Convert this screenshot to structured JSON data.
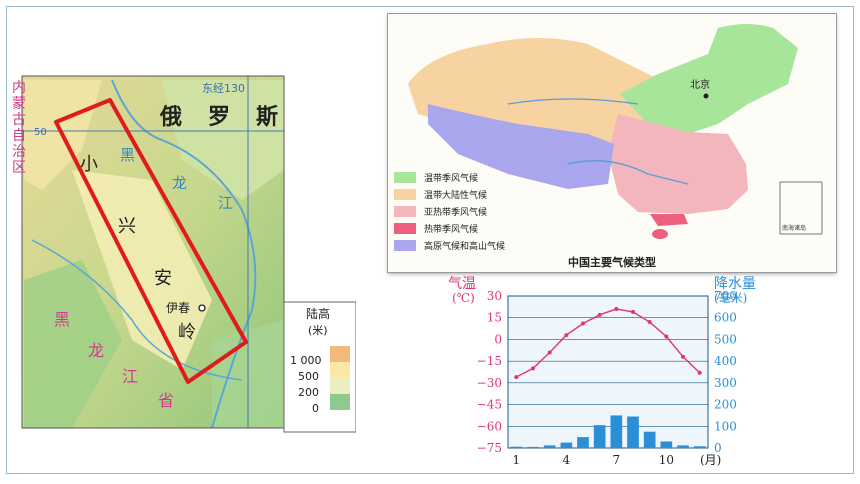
{
  "left_map": {
    "region_label": [
      "内",
      "蒙",
      "古",
      "自",
      "治",
      "区"
    ],
    "lat_label": "50",
    "lon_label": "东经130",
    "russia": [
      "俄",
      "罗",
      "斯"
    ],
    "range_name": [
      "小",
      "兴",
      "安",
      "岭"
    ],
    "river_label": [
      "黑",
      "龙",
      "江"
    ],
    "province_label": [
      "黑",
      "龙",
      "江",
      "省"
    ],
    "city": "伊春",
    "legend": {
      "title": "陆高",
      "unit": "(米)",
      "levels": [
        "1 000",
        "500",
        "200",
        "0"
      ],
      "colors": [
        "#f3b978",
        "#fbe8a6",
        "#e9efc3",
        "#8fc98b"
      ]
    }
  },
  "right_map": {
    "title": "中国主要气候类型",
    "city": "北京",
    "inset_label": "南海诸岛",
    "legend": [
      {
        "label": "温带季风气候",
        "color": "#a7e59a"
      },
      {
        "label": "温带大陆性气候",
        "color": "#f6d3a0"
      },
      {
        "label": "亚热带季风气候",
        "color": "#f4b6bd"
      },
      {
        "label": "热带季风气候",
        "color": "#ee5f7d"
      },
      {
        "label": "高原气候和高山气候",
        "color": "#a9a6ee"
      }
    ]
  },
  "chart_data": {
    "type": "bar+line",
    "left_axis": {
      "label_top": "气温",
      "unit": "(℃)",
      "ticks": [
        "30",
        "15",
        "0",
        "−15",
        "−30",
        "−45",
        "−60",
        "−75"
      ],
      "ylim": [
        -75,
        30
      ]
    },
    "right_axis": {
      "label_top": "降水量",
      "unit": "(毫米)",
      "ticks": [
        "700",
        "600",
        "500",
        "400",
        "300",
        "200",
        "100",
        "0"
      ],
      "ylim": [
        0,
        700
      ]
    },
    "x_ticks": [
      "1",
      "4",
      "7",
      "10"
    ],
    "x_unit": "(月)",
    "months": [
      1,
      2,
      3,
      4,
      5,
      6,
      7,
      8,
      9,
      10,
      11,
      12
    ],
    "temperature": [
      -26,
      -20,
      -9,
      3,
      11,
      17,
      21,
      19,
      12,
      2,
      -12,
      -23
    ],
    "precipitation": [
      6,
      5,
      12,
      25,
      50,
      105,
      150,
      145,
      75,
      30,
      12,
      8
    ],
    "colors": {
      "temp_line": "#e0337a",
      "precip_bar": "#2a8fd6",
      "bg": "#eef6fb"
    }
  }
}
